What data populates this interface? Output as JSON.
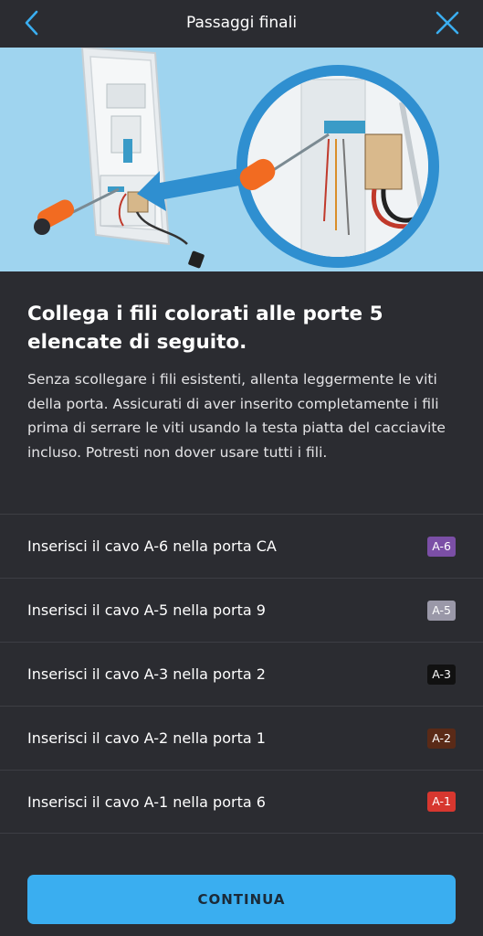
{
  "header": {
    "title": "Passaggi finali",
    "back_icon": "chevron-left-icon",
    "close_icon": "close-icon",
    "accent_color": "#3aaef0"
  },
  "main": {
    "heading": "Collega i fili colorati alle porte 5 elencate di seguito.",
    "description": "Senza scollegare i fili esistenti, allenta leggermente le viti della porta. Assicurati di aver inserito completamente i fili prima di serrare le viti usando la testa piatta del cacciavite incluso. Potresti non dover usare tutti i fili."
  },
  "wires": [
    {
      "label": "Inserisci il cavo A-6 nella porta CA",
      "badge": "A-6",
      "color": "#7b4fa6"
    },
    {
      "label": "Inserisci il cavo A-5 nella porta 9",
      "badge": "A-5",
      "color": "#9a98a8"
    },
    {
      "label": "Inserisci il cavo A-3 nella porta 2",
      "badge": "A-3",
      "color": "#111111"
    },
    {
      "label": "Inserisci il cavo A-2 nella porta 1",
      "badge": "A-2",
      "color": "#5a2a17"
    },
    {
      "label": "Inserisci il cavo A-1 nella porta 6",
      "badge": "A-1",
      "color": "#d7372f"
    }
  ],
  "footer": {
    "continue_label": "CONTINUA"
  }
}
